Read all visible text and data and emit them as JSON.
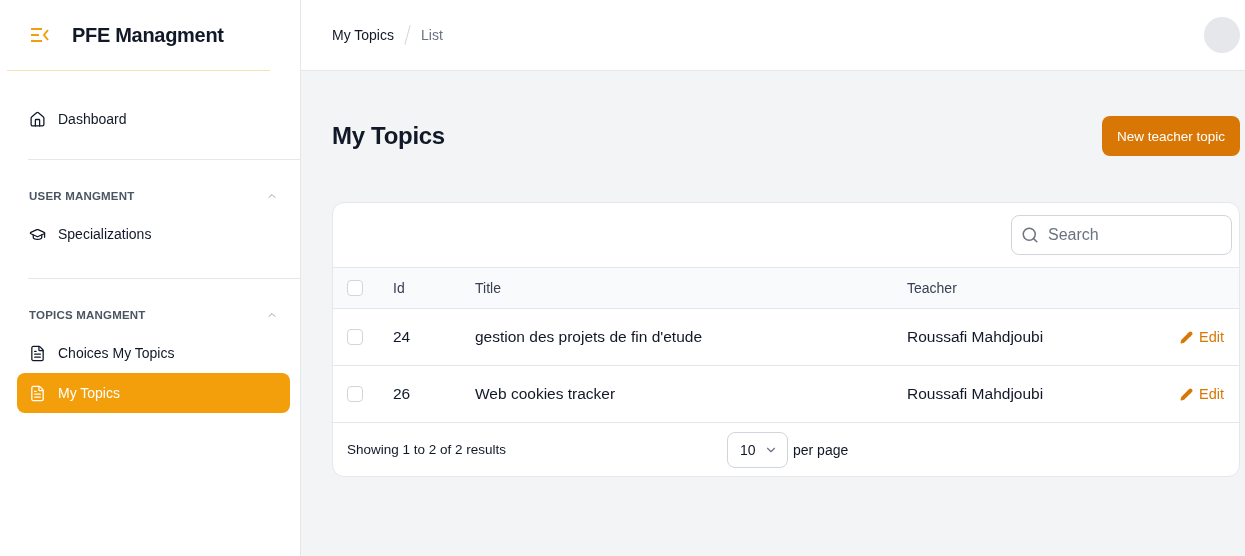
{
  "sidebar": {
    "brand": "PFE Managment",
    "top_items": [
      {
        "label": "Dashboard",
        "selected": false
      }
    ],
    "groups": [
      {
        "label": "USER MANGMENT",
        "expanded": true,
        "items": [
          {
            "label": "Specializations",
            "selected": false
          }
        ]
      },
      {
        "label": "TOPICS MANGMENT",
        "expanded": true,
        "items": [
          {
            "label": "Choices My Topics",
            "selected": false
          },
          {
            "label": "My Topics",
            "selected": true
          }
        ]
      }
    ]
  },
  "breadcrumbs": [
    "My Topics",
    "List"
  ],
  "page": {
    "title": "My Topics",
    "action": "New teacher topic"
  },
  "table": {
    "search": {
      "placeholder": "Search"
    },
    "select_all": {
      "checked": false
    },
    "columns": [
      "Id",
      "Title",
      "Teacher"
    ],
    "rows": [
      {
        "checked": false,
        "cells": [
          "24",
          "gestion des projets de fin d'etude",
          "Roussafi Mahdjoubi"
        ],
        "action": "Edit"
      },
      {
        "checked": false,
        "cells": [
          "26",
          "Web cookies tracker",
          "Roussafi Mahdjoubi"
        ],
        "action": "Edit"
      }
    ],
    "footer": {
      "summary": "Showing 1 to 2 of 2 results",
      "per_page": "10",
      "per_page_label": "per page"
    }
  }
}
